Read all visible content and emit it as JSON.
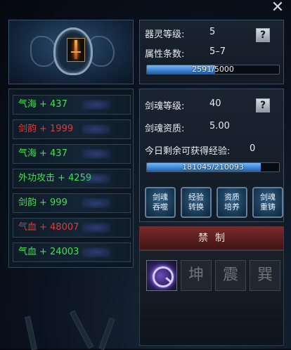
{
  "window": {
    "close_icon": "close-icon"
  },
  "emblem": {
    "icon": "sword-icon"
  },
  "attributes": [
    {
      "name": "气海",
      "value": "+ 437",
      "color": "#3ee34a"
    },
    {
      "name": "剑韵",
      "value": "+ 1999",
      "color": "#e23a33"
    },
    {
      "name": "气海",
      "value": "+ 437",
      "color": "#3ee34a"
    },
    {
      "name": "外功攻击",
      "value": "+ 4259",
      "color": "#3ee34a"
    },
    {
      "name": "剑韵",
      "value": "+ 999",
      "color": "#3ee34a"
    },
    {
      "name": "气血",
      "value": "+ 48007",
      "color": "#e23a33"
    },
    {
      "name": "气血",
      "value": "+ 24003",
      "color": "#3ee34a"
    }
  ],
  "qiling": {
    "level_label": "器灵等级:",
    "level_value": "5",
    "attr_count_label": "属性条数:",
    "attr_count_value": "5–7",
    "exp_text": "2591/5000",
    "exp_fraction": 0.518,
    "help_label": "?"
  },
  "jianhun": {
    "level_label": "剑魂等级:",
    "level_value": "40",
    "quality_label": "剑魂资质:",
    "quality_value": "5.00",
    "daily_exp_label": "今日剩余可获得经验:",
    "daily_exp_value": "0",
    "exp_text": "181045/210093",
    "exp_fraction": 0.862,
    "help_label": "?"
  },
  "actions": [
    {
      "line1": "剑魂",
      "line2": "吞噬"
    },
    {
      "line1": "经验",
      "line2": "转换"
    },
    {
      "line1": "资质",
      "line2": "培养"
    },
    {
      "line1": "剑魂",
      "line2": "重铸"
    }
  ],
  "forbid": {
    "title": "禁制",
    "slots": [
      {
        "char": "",
        "icon": "q-seal-icon"
      },
      {
        "char": "坤"
      },
      {
        "char": "震"
      },
      {
        "char": "巽"
      }
    ]
  }
}
